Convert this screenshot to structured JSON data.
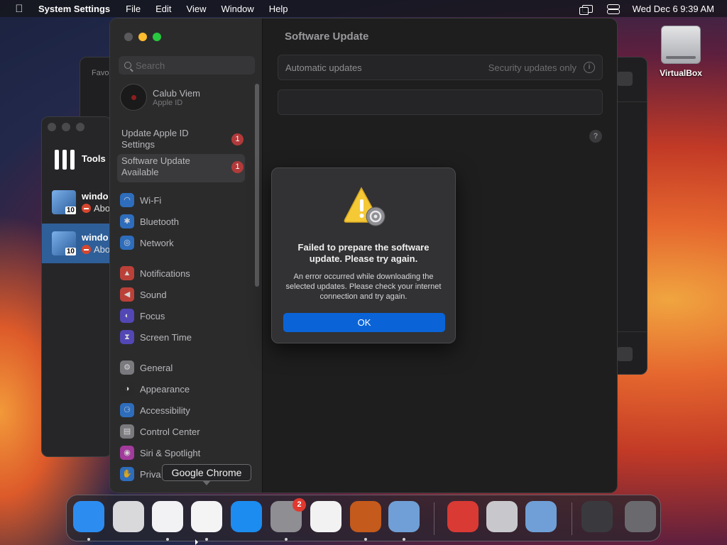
{
  "menubar": {
    "app": "System Settings",
    "menus": [
      "File",
      "Edit",
      "View",
      "Window",
      "Help"
    ],
    "clock": "Wed Dec 6  9:39 AM"
  },
  "desktop": {
    "item_label": "VirtualBox"
  },
  "background_windows": {
    "favorites_label": "Favo",
    "vbox_tools_label": "Tools",
    "vms": [
      {
        "name": "windo",
        "state": "Abo"
      },
      {
        "name": "windo",
        "state": "Abo"
      }
    ]
  },
  "settings": {
    "search_placeholder": "Search",
    "account": {
      "name": "Calub Viem",
      "sub": "Apple ID"
    },
    "alerts": [
      {
        "label": "Update Apple ID Settings",
        "badge": "1"
      },
      {
        "label": "Software Update Available",
        "badge": "1"
      }
    ],
    "nav": [
      {
        "label": "Wi-Fi",
        "color": "#2f7ee0",
        "icon": "wifi-icon"
      },
      {
        "label": "Bluetooth",
        "color": "#2f7ee0",
        "icon": "bluetooth-icon"
      },
      {
        "label": "Network",
        "color": "#2f7ee0",
        "icon": "globe-icon"
      },
      {
        "label": "Notifications",
        "color": "#e0473c",
        "icon": "bell-icon"
      },
      {
        "label": "Sound",
        "color": "#e0473c",
        "icon": "speaker-icon"
      },
      {
        "label": "Focus",
        "color": "#5c4fd6",
        "icon": "moon-icon"
      },
      {
        "label": "Screen Time",
        "color": "#5c4fd6",
        "icon": "hourglass-icon"
      },
      {
        "label": "General",
        "color": "#8e8e93",
        "icon": "gear-icon"
      },
      {
        "label": "Appearance",
        "color": "#2a2a2a",
        "icon": "appearance-icon"
      },
      {
        "label": "Accessibility",
        "color": "#2f7ee0",
        "icon": "accessibility-icon"
      },
      {
        "label": "Control Center",
        "color": "#8e8e93",
        "icon": "control-center-icon"
      },
      {
        "label": "Siri & Spotlight",
        "color": "#c03fb8",
        "icon": "siri-icon"
      },
      {
        "label": "Priva",
        "color": "#2f7ee0",
        "icon": "hand-icon"
      }
    ],
    "main": {
      "title": "Software Update",
      "auto_label": "Automatic updates",
      "auto_value": "Security updates only",
      "help": "?"
    }
  },
  "dialog": {
    "title": "Failed to prepare the software update. Please try again.",
    "message": "An error occurred while downloading the selected updates. Please check your internet connection and try again.",
    "ok_label": "OK"
  },
  "tooltip": "Google Chrome",
  "dock": {
    "settings_badge": "2",
    "apps": [
      {
        "name": "finder-icon",
        "color": "#2d8cf0",
        "running": true
      },
      {
        "name": "launchpad-icon",
        "color": "#d9d9dc",
        "running": false
      },
      {
        "name": "safari-icon",
        "color": "#f2f2f4",
        "running": true
      },
      {
        "name": "chrome-icon",
        "color": "#f4f4f4",
        "running": true
      },
      {
        "name": "app-store-icon",
        "color": "#1c8cf0",
        "running": false
      },
      {
        "name": "system-settings-icon",
        "color": "#8e8e93",
        "running": true
      },
      {
        "name": "textedit-icon",
        "color": "#f2f2f2",
        "running": false
      },
      {
        "name": "garageband-icon",
        "color": "#c45a1c",
        "running": true
      },
      {
        "name": "virtualbox-icon",
        "color": "#6f9fd6",
        "running": true
      },
      {
        "name": "photo-booth-icon",
        "color": "#d93a34",
        "running": false
      },
      {
        "name": "game-controller-icon",
        "color": "#c8c8cc",
        "running": false
      },
      {
        "name": "virtualbox-alt-icon",
        "color": "#6f9fd6",
        "running": false
      },
      {
        "name": "chrome-window-icon",
        "color": "#3a3a3e",
        "running": false
      },
      {
        "name": "trash-icon",
        "color": "#6a6a6e",
        "running": false
      }
    ]
  }
}
